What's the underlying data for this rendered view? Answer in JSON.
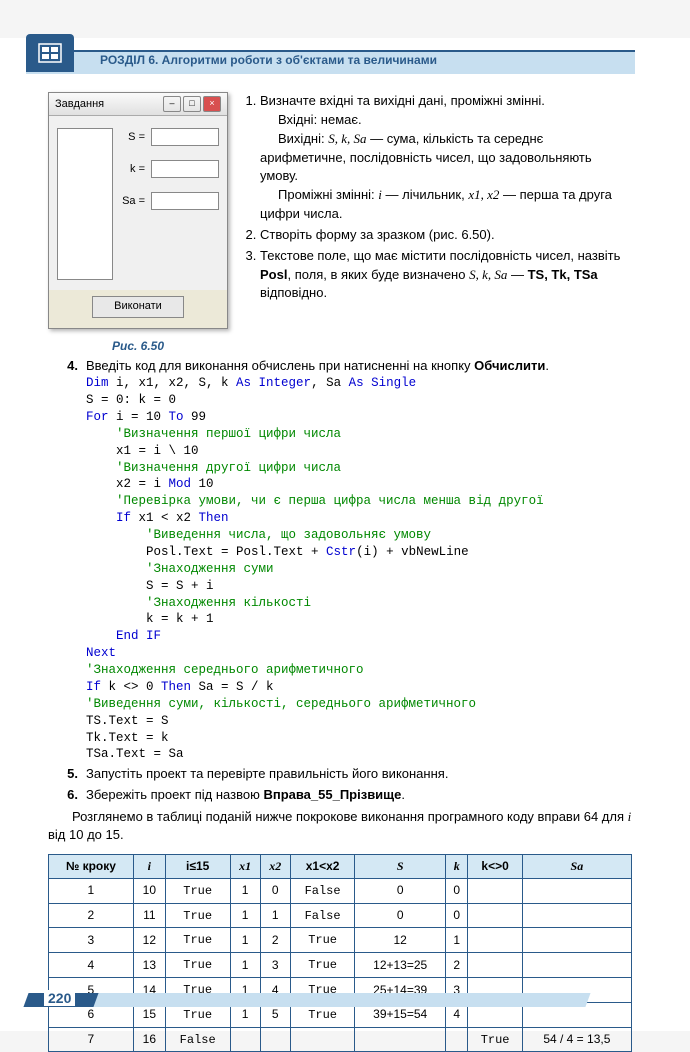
{
  "header": {
    "title": "РОЗДІЛ 6. Алгоритми роботи з об'єктами та величинами"
  },
  "form": {
    "title": "Завдання",
    "labels": {
      "s": "S =",
      "k": "k =",
      "sa": "Sa ="
    },
    "button": "Виконати"
  },
  "figCaption": "Рис. 6.50",
  "items": {
    "i1": {
      "line1": "Визначте вхідні та вихідні дані, проміжні змінні.",
      "line2": "Вхідні: немає.",
      "line3a": "Вихідні: ",
      "line3vars": "S, k, Sa",
      "line3b": " — сума, кількість та середнє арифметичне, послідовність чисел, що задовольняють умову.",
      "line4a": "Проміжні змінні: ",
      "line4i": "i",
      "line4b": " — лічильник, ",
      "line4x": "x1, x2",
      "line4c": " — перша та друга цифри числа."
    },
    "i2": "Створіть форму за зразком (рис. 6.50).",
    "i3a": "Текстове поле, що має містити послідовність чисел, назвіть ",
    "i3b": "Posl",
    "i3c": ", поля, в яких буде визначено ",
    "i3vars": "S, k, Sa",
    "i3d": " — ",
    "i3e": "TS, Tk, TSa",
    "i3f": " відповідно.",
    "i4": "Введіть код для виконання обчислень при натисненні на кнопку ",
    "i4b": "Обчислити",
    "i4c": ".",
    "i5": "Запустіть проект та перевірте правильність його виконання.",
    "i6a": "Збережіть проект під назвою ",
    "i6b": "Вправа_55_Прізвище",
    "i6c": "."
  },
  "code": {
    "l1a": "Dim",
    "l1b": " i, x1, x2, S, k ",
    "l1c": "As Integer",
    "l1d": ", Sa ",
    "l1e": "As Single",
    "l2": "S = 0: k = 0",
    "l3a": "For",
    "l3b": " i = 10 ",
    "l3c": "To",
    "l3d": " 99",
    "l4": "    'Визначення першої цифри числа",
    "l5": "    x1 = i \\ 10",
    "l6": "    'Визначення другої цифри числа",
    "l7a": "    x2 = i ",
    "l7b": "Mod",
    "l7c": " 10",
    "l8": "    'Перевірка умови, чи є перша цифра числа менша від другої",
    "l9a": "    If",
    "l9b": " x1 < x2 ",
    "l9c": "Then",
    "l10": "        'Виведення числа, що задовольняє умову",
    "l11a": "        Posl.Text = Posl.Text + ",
    "l11b": "Cstr",
    "l11c": "(i) + vbNewLine",
    "l12": "        'Знаходження суми",
    "l13": "        S = S + i",
    "l14": "        'Знаходження кількості",
    "l15": "        k = k + 1",
    "l16": "    End IF",
    "l17": "Next",
    "l18": "'Знаходження середнього арифметичного",
    "l19a": "If",
    "l19b": " k <> 0 ",
    "l19c": "Then",
    "l19d": " Sa = S / k",
    "l20": "'Виведення суми, кількості, середнього арифметичного",
    "l21": "TS.Text = S",
    "l22": "Tk.Text = k",
    "l23": "TSa.Text = Sa"
  },
  "para": {
    "a": "Розглянемо в таблиці поданій нижче покрокове виконання програмного коду вправи 64 для ",
    "b": "i",
    "c": " від 10 до 15."
  },
  "table": {
    "headers": [
      "№ кроку",
      "i",
      "i≤15",
      "x1",
      "x2",
      "x1<x2",
      "S",
      "k",
      "k<>0",
      "Sa"
    ],
    "rows": [
      [
        "1",
        "10",
        "True",
        "1",
        "0",
        "False",
        "0",
        "0",
        "",
        ""
      ],
      [
        "2",
        "11",
        "True",
        "1",
        "1",
        "False",
        "0",
        "0",
        "",
        ""
      ],
      [
        "3",
        "12",
        "True",
        "1",
        "2",
        "True",
        "12",
        "1",
        "",
        ""
      ],
      [
        "4",
        "13",
        "True",
        "1",
        "3",
        "True",
        "12+13=25",
        "2",
        "",
        ""
      ],
      [
        "5",
        "14",
        "True",
        "1",
        "4",
        "True",
        "25+14=39",
        "3",
        "",
        ""
      ],
      [
        "6",
        "15",
        "True",
        "1",
        "5",
        "True",
        "39+15=54",
        "4",
        "",
        ""
      ],
      [
        "7",
        "16",
        "False",
        "",
        "",
        "",
        "",
        "",
        "True",
        "54 / 4 = 13,5"
      ]
    ]
  },
  "pageNum": "220"
}
